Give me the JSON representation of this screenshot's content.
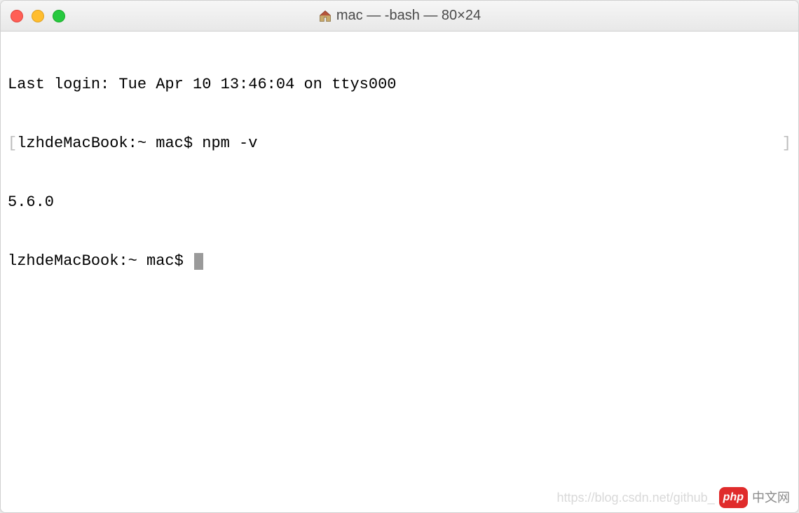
{
  "window": {
    "title": "mac — -bash — 80×24"
  },
  "terminal": {
    "last_login": "Last login: Tue Apr 10 13:46:04 on ttys000",
    "line2_bracket_open": "[",
    "line2_prompt": "lzhdeMacBook:~ mac$ ",
    "line2_command": "npm -v",
    "line2_bracket_close": "]",
    "output": "5.6.0",
    "line4_prompt": "lzhdeMacBook:~ mac$ "
  },
  "watermark": {
    "url": "https://blog.csdn.net/github_",
    "badge": "php",
    "cn": "中文网"
  }
}
